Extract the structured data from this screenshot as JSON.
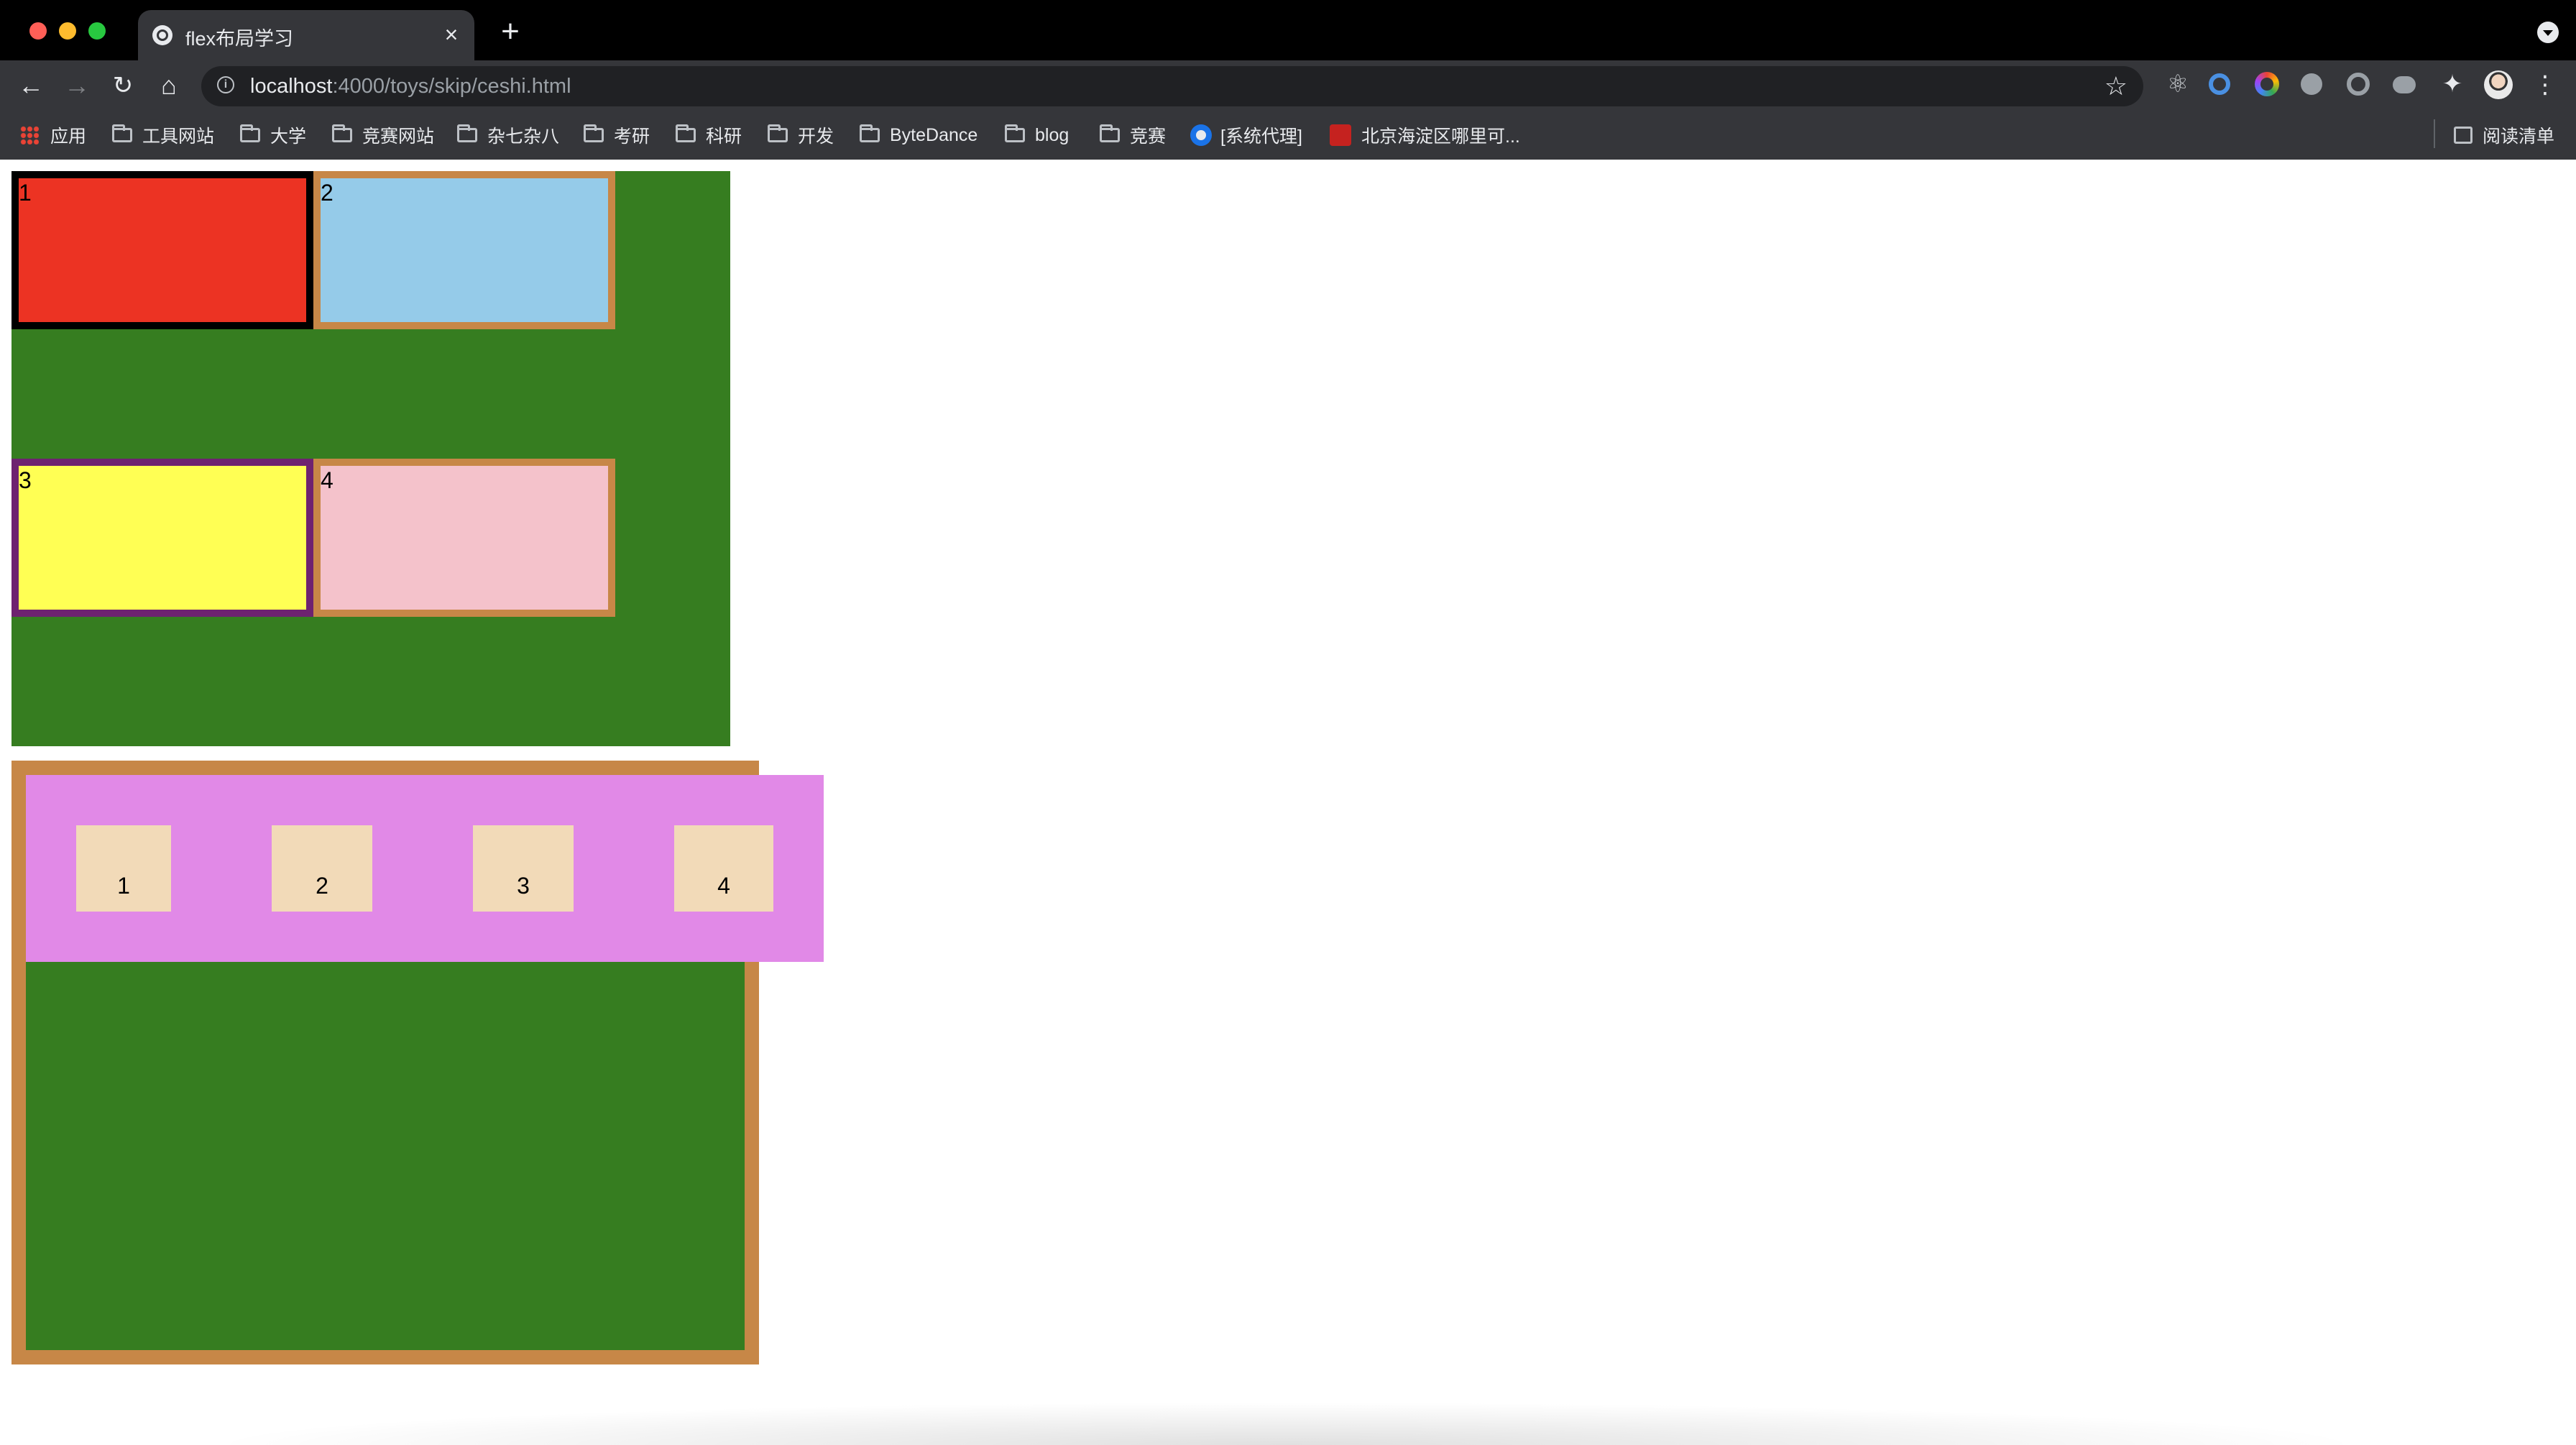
{
  "tab": {
    "title": "flex布局学习"
  },
  "address_bar": {
    "host": "localhost",
    "rest": ":4000/toys/skip/ceshi.html"
  },
  "bookmarks": {
    "items": [
      {
        "label": "应用",
        "icon": "apps-grid-icon"
      },
      {
        "label": "工具网站",
        "icon": "folder-icon"
      },
      {
        "label": "大学",
        "icon": "folder-icon"
      },
      {
        "label": "竞赛网站",
        "icon": "folder-icon"
      },
      {
        "label": "杂七杂八",
        "icon": "folder-icon"
      },
      {
        "label": "考研",
        "icon": "folder-icon"
      },
      {
        "label": "科研",
        "icon": "folder-icon"
      },
      {
        "label": "开发",
        "icon": "folder-icon"
      },
      {
        "label": "ByteDance",
        "icon": "folder-icon"
      },
      {
        "label": "blog",
        "icon": "folder-icon"
      },
      {
        "label": "竞赛",
        "icon": "folder-icon"
      },
      {
        "label": "[系统代理]",
        "icon": "proxy-icon"
      },
      {
        "label": "北京海淀区哪里可...",
        "icon": "red-badge-icon"
      }
    ],
    "reading_list": "阅读清单"
  },
  "page": {
    "grid_cells": [
      "1",
      "2",
      "3",
      "4"
    ],
    "flex_items": [
      "1",
      "2",
      "3",
      "4"
    ]
  },
  "colors": {
    "container_green": "#367d20",
    "cell_1": "#ec3323",
    "cell_2": "#95cbe9",
    "cell_3": "#ffff54",
    "cell_4": "#f4c2cb",
    "border_brown": "#c78747",
    "border_purple": "#6e2270",
    "flex_row_pink": "#e189e7",
    "flex_item_beige": "#f2dab8"
  }
}
